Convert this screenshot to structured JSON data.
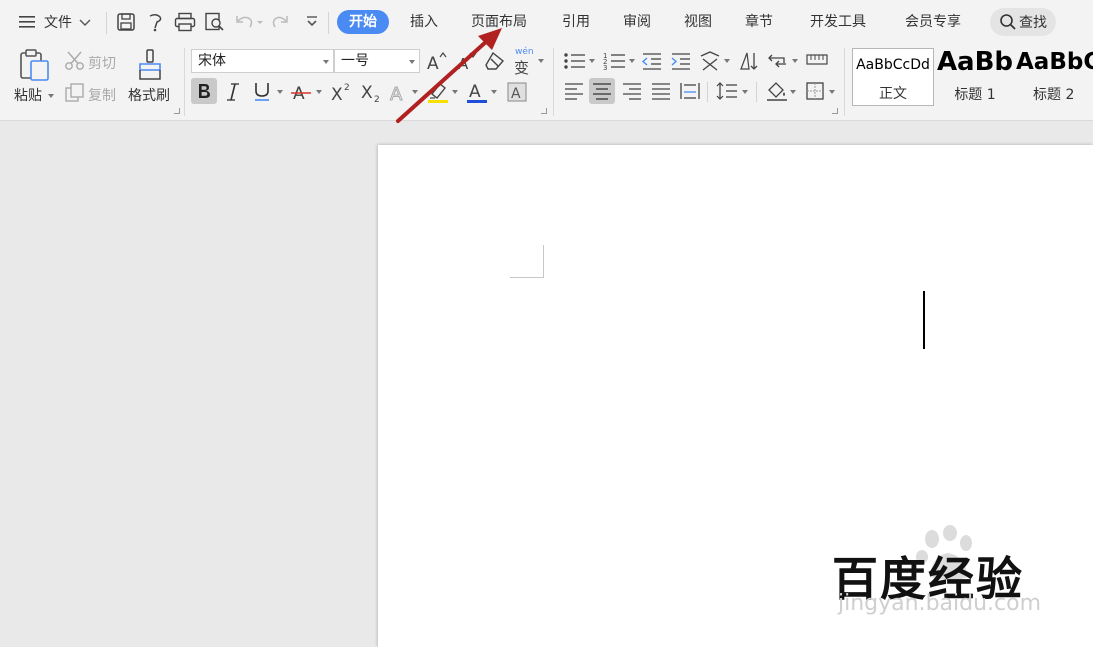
{
  "topbar": {
    "file_menu_label": "文件",
    "tabs": [
      "开始",
      "插入",
      "页面布局",
      "引用",
      "审阅",
      "视图",
      "章节",
      "开发工具",
      "会员专享"
    ],
    "active_tab": "开始",
    "search_label": "查找"
  },
  "ribbon": {
    "clipboard": {
      "paste_label": "粘贴",
      "cut_label": "剪切",
      "copy_label": "复制",
      "format_painter_label": "格式刷"
    },
    "font": {
      "font_name": "宋体",
      "font_size": "一号",
      "phonetic_glyph_top": "wén",
      "phonetic_glyph": "变"
    },
    "styles": [
      {
        "preview": "AaBbCcDd",
        "name": "正文"
      },
      {
        "preview": "AaBb",
        "name": "标题 1"
      },
      {
        "preview": "AaBbC",
        "name": "标题 2"
      }
    ]
  },
  "document": {
    "watermark_text": "百度经验",
    "watermark_url": "jingyan.baidu.com"
  },
  "colors": {
    "accent": "#4a8bf3",
    "annotation_arrow": "#b0211f",
    "highlight_yellow": "#f7e000",
    "font_color_red": "#d9342b",
    "font_color_blue": "#1f4fd8"
  }
}
